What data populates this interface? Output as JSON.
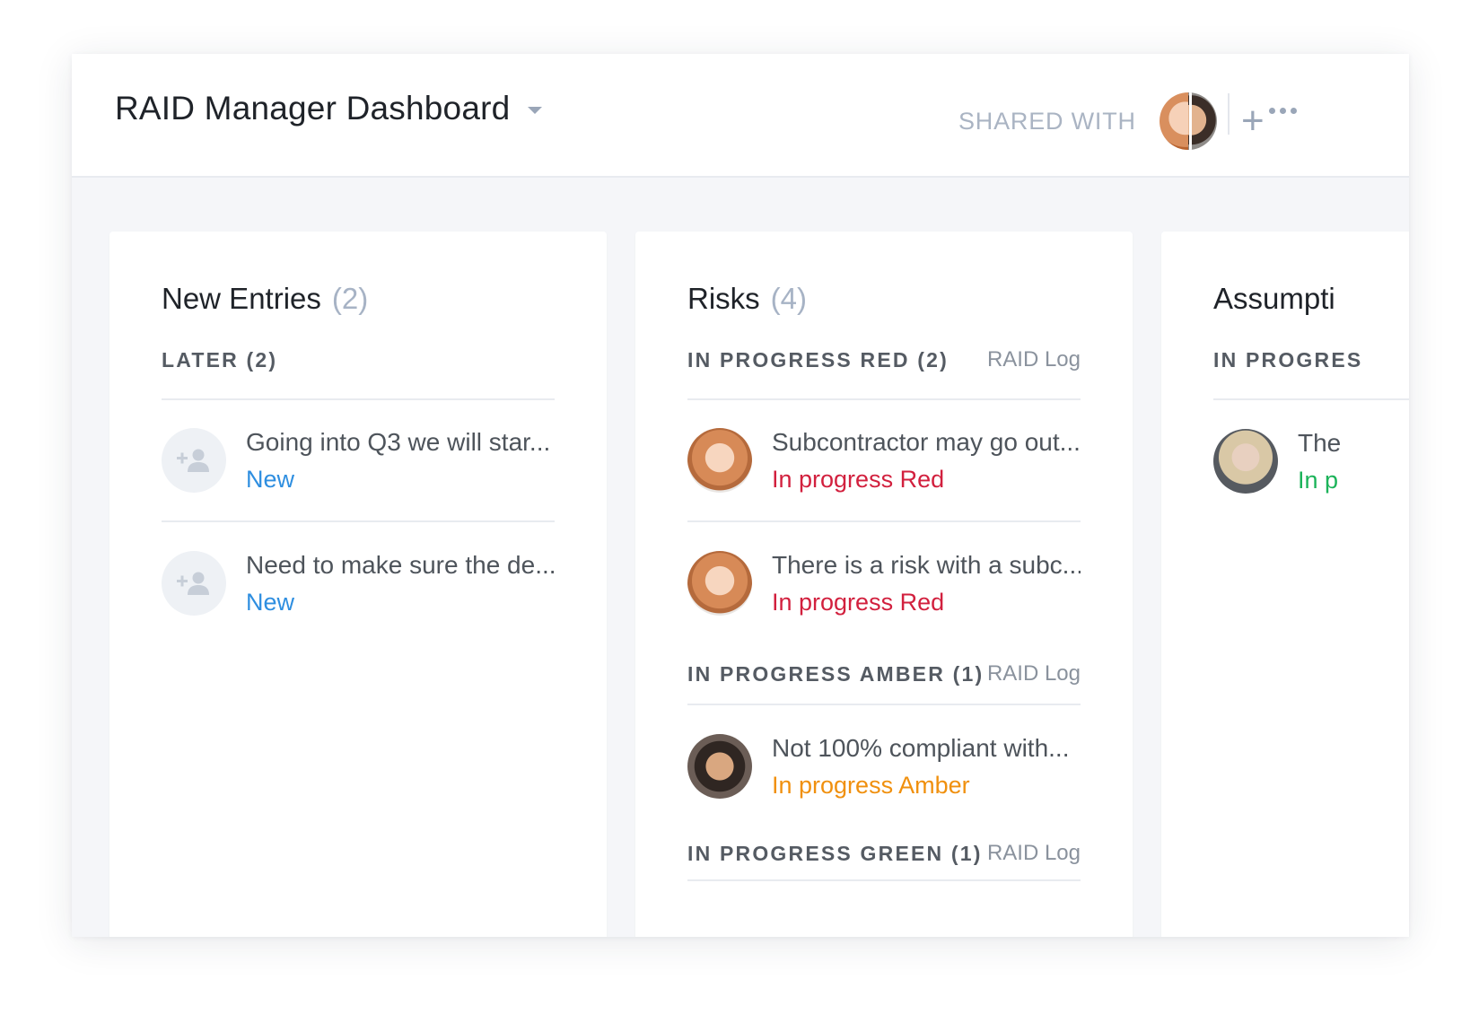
{
  "header": {
    "title": "RAID Manager Dashboard",
    "shared_label": "SHARED WITH",
    "add_symbol": "+"
  },
  "columns": [
    {
      "name": "New Entries",
      "count": "(2)",
      "groups": [
        {
          "name": "LATER (2)",
          "link": "",
          "items": [
            {
              "title": "Going into Q3 we will star...",
              "status": "New",
              "avatar": "empty"
            },
            {
              "title": "Need to make sure the de...",
              "status": "New",
              "avatar": "empty"
            }
          ]
        }
      ]
    },
    {
      "name": "Risks",
      "count": "(4)",
      "groups": [
        {
          "name": "IN PROGRESS RED (2)",
          "link": "RAID Log",
          "items": [
            {
              "title": "Subcontractor may go out...",
              "status": "In progress Red",
              "avatar": "woman1"
            },
            {
              "title": "There is a risk with a subc...",
              "status": "In progress Red",
              "avatar": "woman1"
            }
          ]
        },
        {
          "name": "IN PROGRESS AMBER (1)",
          "link": "RAID Log",
          "items": [
            {
              "title": "Not 100% compliant with...",
              "status": "In progress Amber",
              "avatar": "man1"
            }
          ]
        },
        {
          "name": "IN PROGRESS GREEN (1)",
          "link": "RAID Log",
          "items": []
        }
      ]
    },
    {
      "name": "Assumpti",
      "count": "",
      "groups": [
        {
          "name": "IN PROGRES",
          "link": "",
          "items": [
            {
              "title": "The",
              "status": "In p",
              "avatar": "woman2"
            }
          ]
        }
      ]
    }
  ],
  "colors": {
    "new": "#2e8ee0",
    "red": "#d2203e",
    "amber": "#f0900e",
    "green": "#1cb35a"
  },
  "icons": {
    "title_dropdown": "chevron-down-icon",
    "add": "plus-icon",
    "more": "more-horizontal-icon",
    "empty_avatar": "add-person-icon"
  }
}
